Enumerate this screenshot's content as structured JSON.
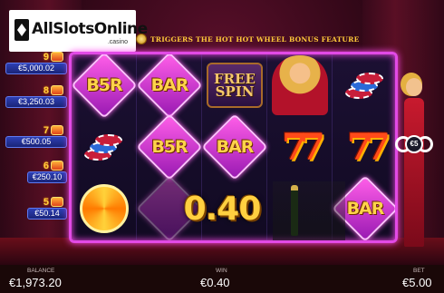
{
  "logo": {
    "brand": "AllSlotsOnline",
    "suffix": ".casino"
  },
  "banner": {
    "text": "TRIGGERS THE HOT HOT WHEEL BONUS FEATURE",
    "icon": "hot-wheel-coin-icon"
  },
  "jackpots": [
    {
      "level": "9",
      "value": "€5,000.02"
    },
    {
      "level": "8",
      "value": "€3,250.03"
    },
    {
      "level": "7",
      "value": "€500.05"
    },
    {
      "level": "6",
      "value": "€250.10"
    },
    {
      "level": "5",
      "value": "€50.14"
    }
  ],
  "reels": {
    "symbols": {
      "bbr": "B5R",
      "bar": "BAR",
      "free_spin": "FREE SPIN",
      "seven": "77"
    },
    "grid": [
      [
        "chips",
        "chips",
        "hot-wheel"
      ],
      [
        "bar",
        "b5r",
        "b5r"
      ],
      [
        "free-spin",
        "bar",
        "bottle"
      ],
      [
        "lady",
        "seven",
        "seven"
      ],
      [
        "chips",
        "seven",
        "bar"
      ]
    ]
  },
  "win_display": "0.40",
  "bet_spinner": {
    "value": "€5"
  },
  "bottom_bar": {
    "balance_label": "BALANCE",
    "balance_value": "€1,973.20",
    "win_label": "WIN",
    "win_value": "€0.40",
    "bet_label": "BET",
    "bet_value": "€5.00"
  },
  "colors": {
    "reel_frame": "#e24ae6",
    "jackpot_pill": "#2d3fb4",
    "gold": "#ffd040"
  }
}
